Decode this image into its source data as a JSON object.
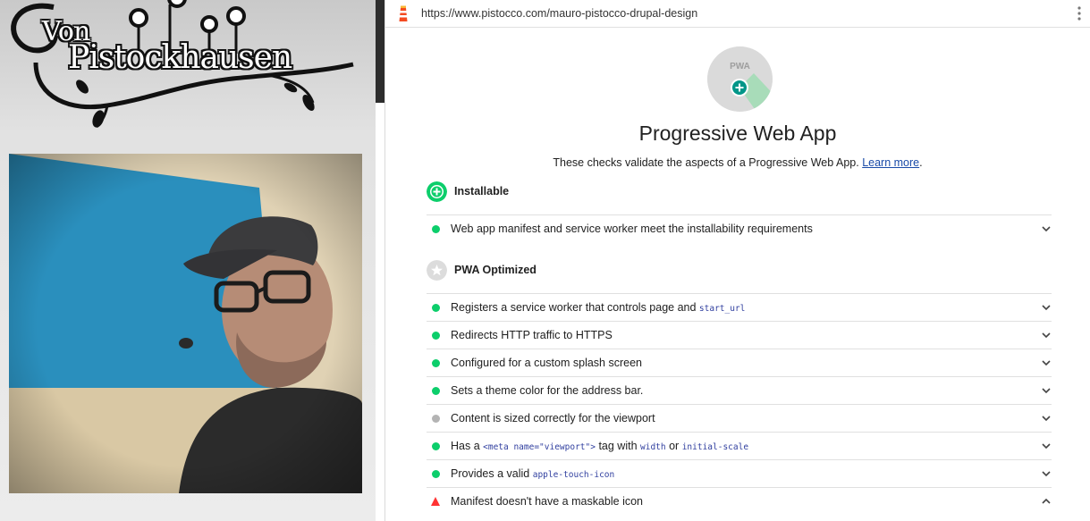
{
  "left": {
    "logo": {
      "line1": "Von",
      "line2": "Pistockhausen"
    }
  },
  "browser": {
    "url": "https://www.pistocco.com/mauro-pistocco-drupal-design"
  },
  "report": {
    "badge_text": "PWA",
    "title": "Progressive Web App",
    "description": "These checks validate the aspects of a Progressive Web App.",
    "learn_more": "Learn more",
    "learn_more_suffix": ".",
    "groups": {
      "installable": {
        "title": "Installable"
      },
      "optimized": {
        "title": "PWA Optimized"
      }
    },
    "audits": [
      {
        "status": "pass",
        "parts": [
          "Web app manifest and service worker meet the installability requirements"
        ]
      },
      {
        "status": "pass",
        "parts": [
          "Registers a service worker that controls page and ",
          "start_url"
        ]
      },
      {
        "status": "pass",
        "parts": [
          "Redirects HTTP traffic to HTTPS"
        ]
      },
      {
        "status": "pass",
        "parts": [
          "Configured for a custom splash screen"
        ]
      },
      {
        "status": "pass",
        "parts": [
          "Sets a theme color for the address bar."
        ]
      },
      {
        "status": "neutral",
        "parts": [
          "Content is sized correctly for the viewport"
        ]
      },
      {
        "status": "pass",
        "parts": [
          "Has a ",
          "<meta name=\"viewport\">",
          " tag with ",
          "width",
          " or ",
          "initial-scale"
        ]
      },
      {
        "status": "pass",
        "parts": [
          "Provides a valid ",
          "apple-touch-icon"
        ]
      },
      {
        "status": "fail",
        "parts": [
          "Manifest doesn't have a maskable icon"
        ]
      }
    ]
  },
  "colors": {
    "pass": "#0cce6b",
    "neutral": "#b4b4b4",
    "fail": "#ff3333",
    "link": "#1a4ba8",
    "code": "#303f9f"
  },
  "icons": [
    "lighthouse-icon",
    "more-vert-icon",
    "pwa-badge-icon",
    "installable-plus-icon",
    "optimized-star-icon",
    "chevron-down-icon",
    "chevron-up-icon"
  ]
}
